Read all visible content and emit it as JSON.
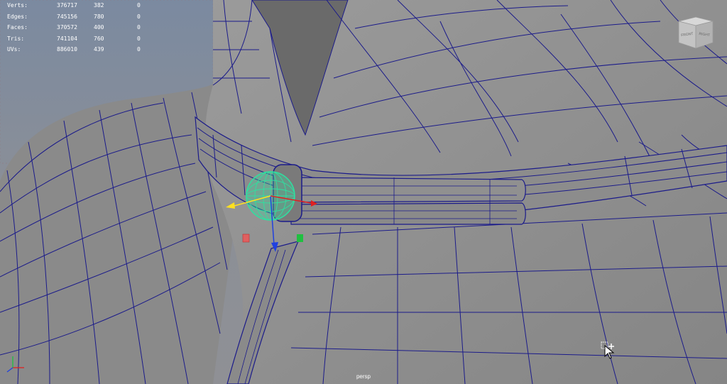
{
  "viewport": {
    "camera_name": "persp",
    "background_top": "#7d8da3",
    "background_bottom": "#8d8f94",
    "mesh_color": "#8f8f8f",
    "wire_color": "#1a1a8c",
    "selection_color": "#2fe0a0"
  },
  "hud": {
    "rows": [
      {
        "label": "Verts:",
        "total": "376717",
        "selected": "382",
        "extra": "0"
      },
      {
        "label": "Edges:",
        "total": "745156",
        "selected": "780",
        "extra": "0"
      },
      {
        "label": "Faces:",
        "total": "370572",
        "selected": "400",
        "extra": "0"
      },
      {
        "label": "Tris:",
        "total": "741104",
        "selected": "760",
        "extra": "0"
      },
      {
        "label": "UVs:",
        "total": "886010",
        "selected": "439",
        "extra": "0"
      }
    ]
  },
  "viewcube": {
    "face_front": "FRONT",
    "face_right": "RIGHT"
  },
  "manipulator": {
    "x_color": "#e02020",
    "y_color": "#20c040",
    "z_color": "#2040e0",
    "pivot_color": "#ffe020"
  },
  "icons": {
    "axis": "axis-indicator-icon",
    "cursor": "move-cursor-icon"
  }
}
